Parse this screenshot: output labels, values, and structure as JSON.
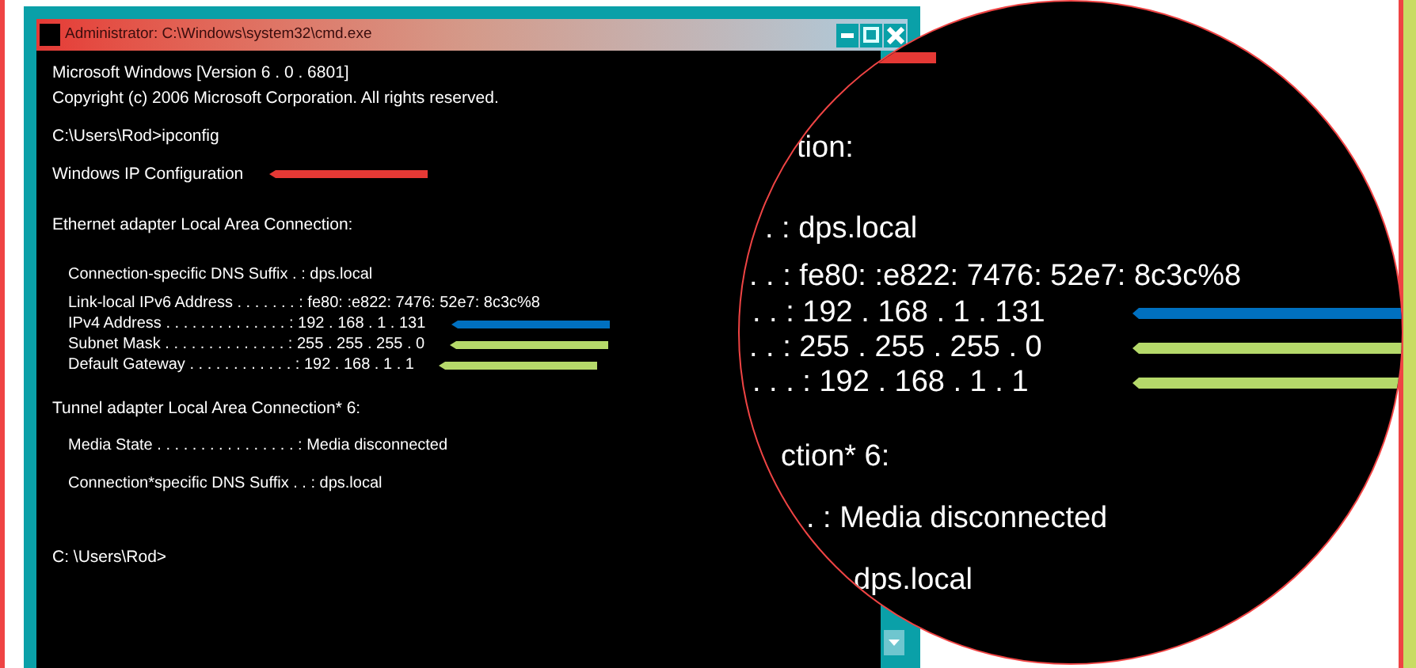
{
  "window": {
    "title": "Administrator: C:\\Windows\\system32\\cmd.exe"
  },
  "console": {
    "lines": [
      {
        "kind": "plain",
        "text": "Microsoft Windows [Version 6 . 0 . 6801]"
      },
      {
        "kind": "plain",
        "text": "Copyright (c) 2006 Microsoft Corporation.  All rights reserved."
      },
      {
        "kind": "plain",
        "text": "C:\\Users\\Rod>ipconfig"
      },
      {
        "kind": "plain",
        "text": "Windows IP Configuration",
        "color": "#e53935"
      },
      {
        "kind": "plain",
        "text": "Ethernet adapter Local Area Connection:"
      },
      {
        "kind": "detail",
        "text": "Connection-specific DNS Suffix . : dps.local"
      },
      {
        "kind": "detail",
        "text": "Link-local IPv6 Address . . . . . . . : fe80: :e822: 7476: 52e7: 8c3c%8"
      },
      {
        "kind": "detail",
        "text": "IPv4 Address . . . . . . . . . . . . . . : 192 . 168 . 1 . 131",
        "color": "#0070c0"
      },
      {
        "kind": "detail",
        "text": "Subnet Mask . . . . . . . . . . . . . . : 255 . 255 . 255 . 0",
        "color": "#b5d96a"
      },
      {
        "kind": "detail",
        "text": "Default Gateway . . . . . . . . . . . . : 192 . 168 . 1 . 1",
        "color": "#b5d96a"
      },
      {
        "kind": "plain",
        "text": "Tunnel adapter Local Area Connection* 6:"
      },
      {
        "kind": "detail",
        "text": "Media State . . . . . . . . . . . . . . . . : Media disconnected"
      },
      {
        "kind": "detail",
        "text": "Connection*specific DNS Suffix . . : dps.local"
      },
      {
        "kind": "plain",
        "text": "C: \\Users\\Rod>"
      }
    ]
  },
  "magnifier": {
    "lines": [
      {
        "text": "tion:"
      },
      {
        "text": ". : dps.local"
      },
      {
        "text": ". . : fe80: :e822: 7476: 52e7: 8c3c%8"
      },
      {
        "text": ". . : 192 . 168 . 1 . 131",
        "color": "#0070c0"
      },
      {
        "text": ". . : 255 . 255 . 255 . 0",
        "color": "#b5d96a"
      },
      {
        "text": ". . . : 192 . 168 . 1 . 1",
        "color": "#b5d96a"
      },
      {
        "text": "ction* 6:"
      },
      {
        "text": ". : Media disconnected"
      },
      {
        "text": "dps.local"
      }
    ]
  }
}
